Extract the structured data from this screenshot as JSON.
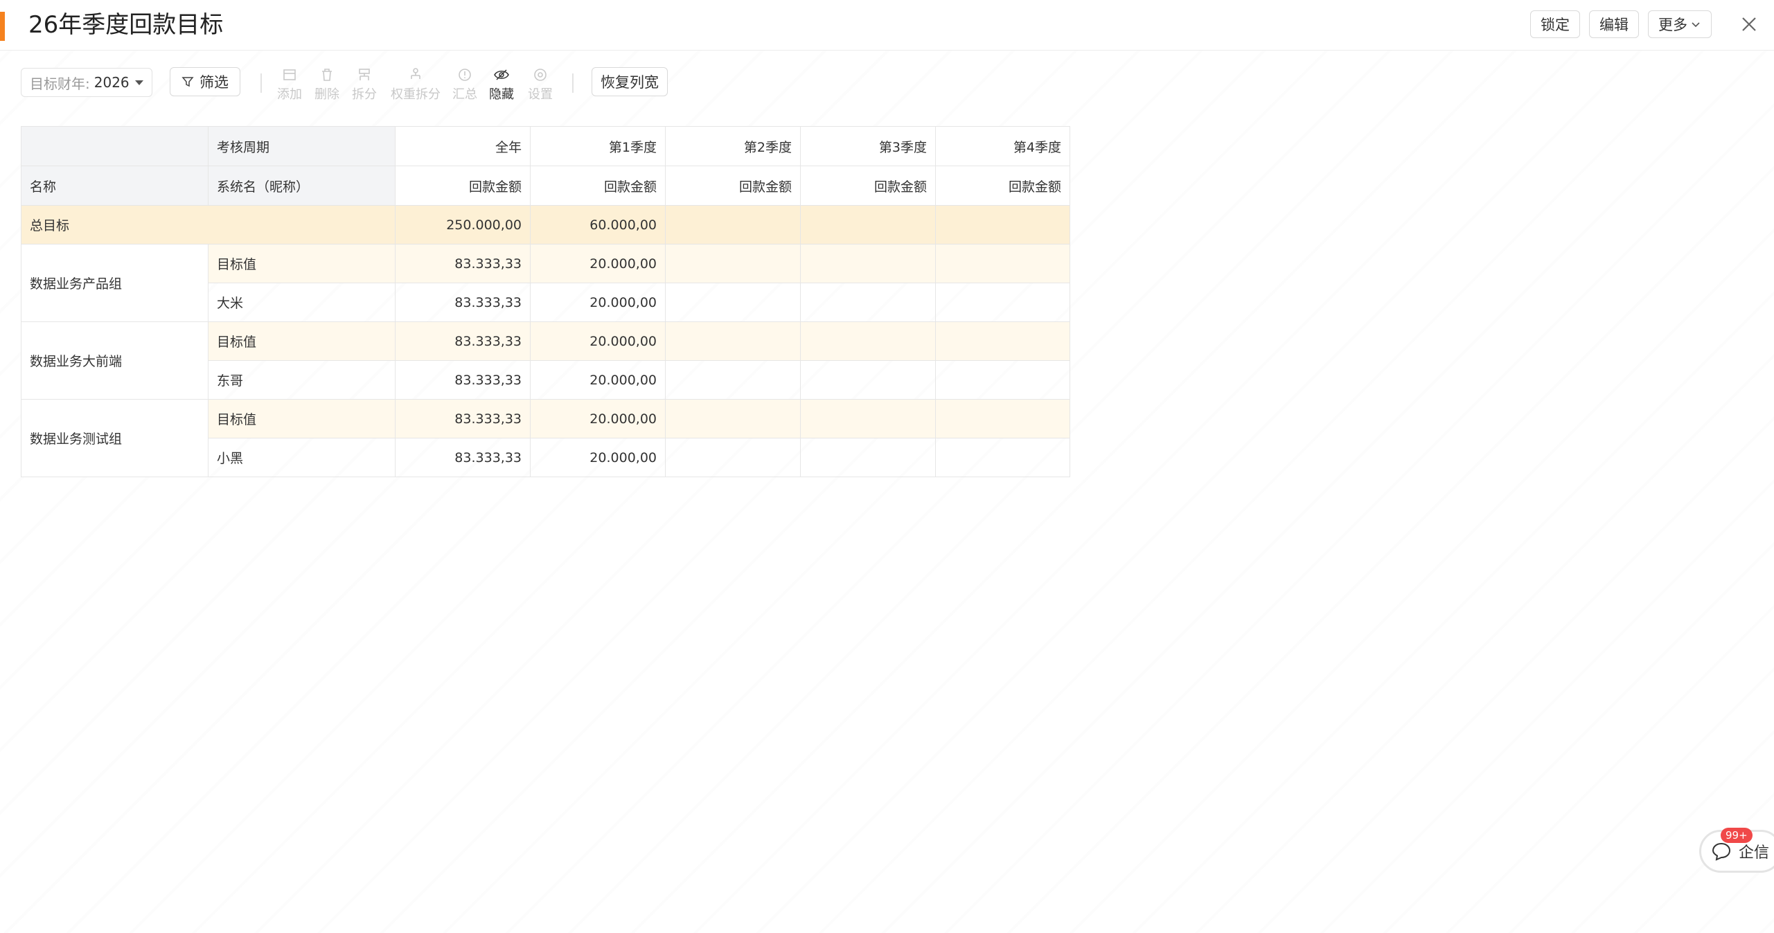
{
  "header": {
    "title": "26年季度回款目标",
    "buttons": {
      "lock": "锁定",
      "edit": "编辑",
      "more": "更多"
    }
  },
  "toolbar": {
    "year_label": "目标财年:",
    "year_value": "2026",
    "filter": "筛选",
    "tools": {
      "add": "添加",
      "delete": "删除",
      "split": "拆分",
      "weight_split": "权重拆分",
      "summary": "汇总",
      "hide": "隐藏",
      "settings": "设置"
    },
    "restore_width": "恢复列宽"
  },
  "table": {
    "header_row1": {
      "col2": "考核周期",
      "year": "全年",
      "q1": "第1季度",
      "q2": "第2季度",
      "q3": "第3季度",
      "q4": "第4季度"
    },
    "header_row2": {
      "col1": "名称",
      "col2": "系统名（昵称）",
      "year": "回款金额",
      "q1": "回款金额",
      "q2": "回款金额",
      "q3": "回款金额",
      "q4": "回款金额"
    },
    "total": {
      "label": "总目标",
      "year": "250.000,00",
      "q1": "60.000,00",
      "q2": "",
      "q3": "",
      "q4": ""
    },
    "groups": [
      {
        "name": "数据业务产品组",
        "rows": [
          {
            "label": "目标值",
            "year": "83.333,33",
            "q1": "20.000,00",
            "q2": "",
            "q3": "",
            "q4": ""
          },
          {
            "label": "大米",
            "year": "83.333,33",
            "q1": "20.000,00",
            "q2": "",
            "q3": "",
            "q4": ""
          }
        ]
      },
      {
        "name": "数据业务大前端",
        "rows": [
          {
            "label": "目标值",
            "year": "83.333,33",
            "q1": "20.000,00",
            "q2": "",
            "q3": "",
            "q4": ""
          },
          {
            "label": "东哥",
            "year": "83.333,33",
            "q1": "20.000,00",
            "q2": "",
            "q3": "",
            "q4": ""
          }
        ]
      },
      {
        "name": "数据业务测试组",
        "rows": [
          {
            "label": "目标值",
            "year": "83.333,33",
            "q1": "20.000,00",
            "q2": "",
            "q3": "",
            "q4": ""
          },
          {
            "label": "小黑",
            "year": "83.333,33",
            "q1": "20.000,00",
            "q2": "",
            "q3": "",
            "q4": ""
          }
        ]
      }
    ]
  },
  "chat": {
    "label": "企信",
    "badge": "99+"
  },
  "colors": {
    "accent": "#f5821f",
    "total_row": "#fdf0d5",
    "target_row": "#fff9ec",
    "badge": "#f04848"
  }
}
